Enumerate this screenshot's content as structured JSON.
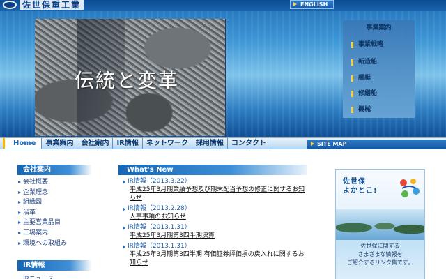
{
  "header": {
    "logo_text": "佐世保重工業",
    "english_label": "ENGLISH",
    "hero_title": "伝統と変革",
    "sitemap_label": "SITE MAP"
  },
  "business_menu": {
    "title": "事業案内",
    "items": [
      "事業戦略",
      "新造船",
      "艦艇",
      "修繕船",
      "機械"
    ]
  },
  "main_nav": {
    "items": [
      "Home",
      "事業案内",
      "会社案内",
      "IR情報",
      "ネットワーク",
      "採用情報",
      "コンタクト"
    ]
  },
  "company_box": {
    "title": "会社案内",
    "items": [
      "会社概要",
      "企業理念",
      "組織図",
      "沿革",
      "主要営業品目",
      "工場案内",
      "環境への取組み"
    ]
  },
  "ir_box": {
    "title": "IR情報",
    "first_item": "IRニュース"
  },
  "news": {
    "title": "What's New",
    "items": [
      {
        "date": "IR情報（2013.3.22）",
        "text": "平成25年3月期業績予想及び期末配当予想の修正に関するお知らせ"
      },
      {
        "date": "IR情報（2013.2.28）",
        "text": "人事事項のお知らせ"
      },
      {
        "date": "IR情報（2013.1.31）",
        "text": "平成25年3月期第3四半期決算"
      },
      {
        "date": "IR情報（2013.1.31）",
        "text": "平成25年3月期第3四半期 有価証券評価損の戻入れに関するお知らせ"
      }
    ]
  },
  "banner": {
    "title_line1": "佐世保",
    "title_line2": "よかとこ!",
    "text_line1": "佐世保に関する",
    "text_line2": "さまざまな情報を",
    "text_line3": "ご紹介するリンク集です。"
  },
  "colors": {
    "accent_blue": "#1566b6",
    "accent_yellow": "#ffd23a",
    "nav_text": "#0d3a73"
  }
}
